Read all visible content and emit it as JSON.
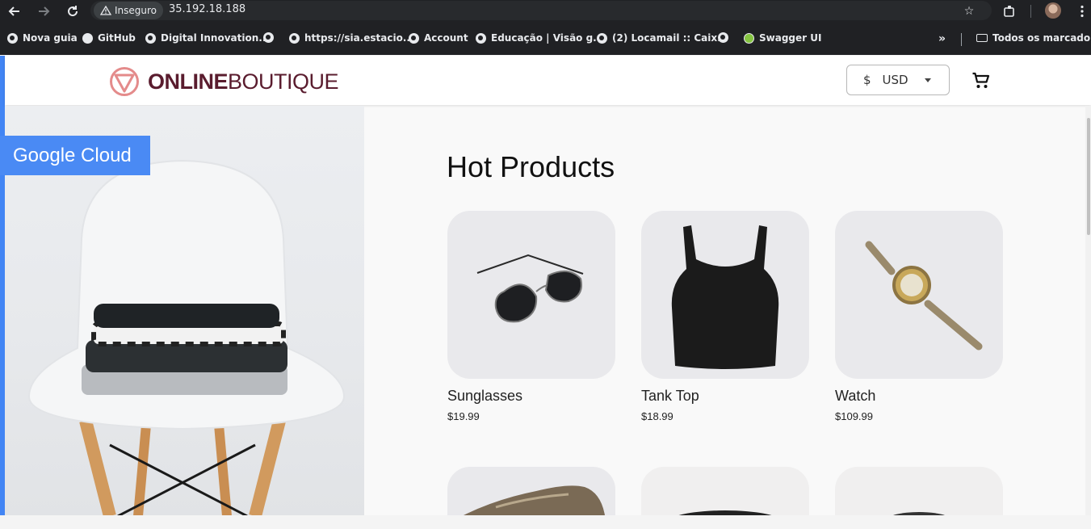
{
  "browser": {
    "security_label": "Inseguro",
    "url": "35.192.18.188",
    "bookmarks": [
      {
        "label": "Nova guia",
        "icon": "globe-icon"
      },
      {
        "label": "GitHub",
        "icon": "github-icon"
      },
      {
        "label": "Digital Innovation...",
        "icon": "globe-icon"
      },
      {
        "label": "",
        "icon": "globe-icon"
      },
      {
        "label": "https://sia.estacio....",
        "icon": "globe-icon"
      },
      {
        "label": "Account",
        "icon": "globe-icon"
      },
      {
        "label": "Educação | Visão g...",
        "icon": "globe-icon"
      },
      {
        "label": "(2) Locamail :: Caix...",
        "icon": "globe-icon"
      },
      {
        "label": "",
        "icon": "globe-icon"
      },
      {
        "label": "Swagger UI",
        "icon": "swagger-icon"
      }
    ],
    "overflow_label": "»",
    "all_bookmarks_label": "Todos os marcadores"
  },
  "header": {
    "brand_bold": "ONLINE",
    "brand_light": "BOUTIQUE",
    "currency_symbol": "$",
    "currency_code": "USD"
  },
  "hero": {
    "badge": "Google Cloud"
  },
  "main": {
    "title": "Hot Products",
    "products": [
      {
        "name": "Sunglasses",
        "price": "$19.99"
      },
      {
        "name": "Tank Top",
        "price": "$18.99"
      },
      {
        "name": "Watch",
        "price": "$109.99"
      }
    ]
  },
  "colors": {
    "accent": "#4285f4",
    "badge": "#4a8af4",
    "brand": "#5a1c2e",
    "logo_mark": "#e48b8b"
  }
}
